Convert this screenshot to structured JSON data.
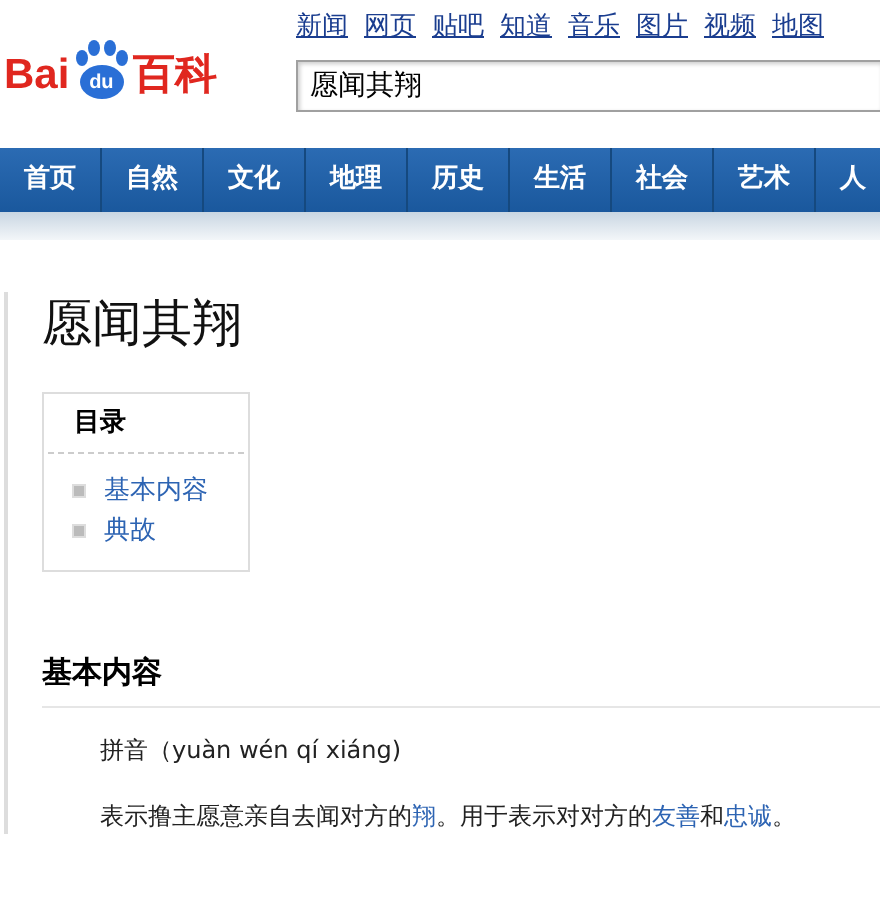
{
  "logo": {
    "left": "Bai",
    "badge": "du",
    "right": "百科"
  },
  "top_links": [
    "新闻",
    "网页",
    "贴吧",
    "知道",
    "音乐",
    "图片",
    "视频",
    "地图"
  ],
  "search": {
    "value": "愿闻其翔"
  },
  "nav": [
    "首页",
    "自然",
    "文化",
    "地理",
    "历史",
    "生活",
    "社会",
    "艺术",
    "人"
  ],
  "title": "愿闻其翔",
  "toc": {
    "heading": "目录",
    "items": [
      "基本内容",
      "典故"
    ]
  },
  "section": {
    "heading": "基本内容",
    "pinyin": "拼音（yuàn wén qí xiáng)",
    "paragraph": [
      {
        "text": "表示撸主愿意亲自去闻对方的",
        "link": false
      },
      {
        "text": "翔",
        "link": true
      },
      {
        "text": "。用于表示对对方的",
        "link": false
      },
      {
        "text": "友善",
        "link": true
      },
      {
        "text": "和",
        "link": false
      },
      {
        "text": "忠诚",
        "link": true
      },
      {
        "text": "。",
        "link": false
      }
    ]
  }
}
